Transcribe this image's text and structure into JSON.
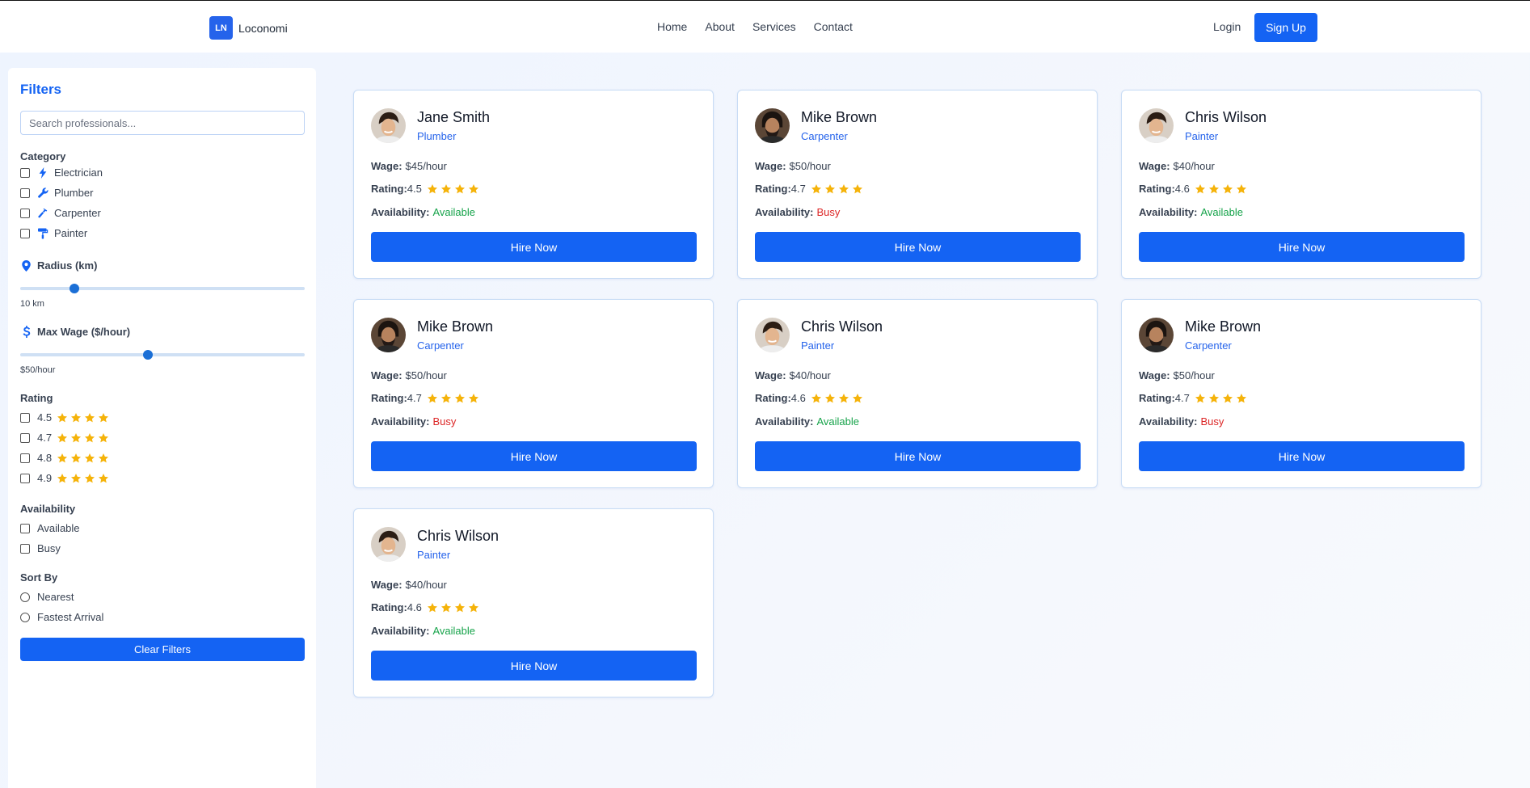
{
  "header": {
    "logo_badge": "LN",
    "app_name": "Loconomi",
    "nav": [
      "Home",
      "About",
      "Services",
      "Contact"
    ],
    "login": "Login",
    "signup": "Sign Up"
  },
  "sidebar": {
    "title": "Filters",
    "search_placeholder": "Search professionals...",
    "category_title": "Category",
    "categories": [
      {
        "label": "Electrician",
        "icon": "bolt-icon"
      },
      {
        "label": "Plumber",
        "icon": "wrench-icon"
      },
      {
        "label": "Carpenter",
        "icon": "hammer-icon"
      },
      {
        "label": "Painter",
        "icon": "paint-roller-icon"
      }
    ],
    "radius_title": "Radius (km)",
    "radius_value": "10 km",
    "radius_fraction": 0.19,
    "wage_title": "Max Wage ($/hour)",
    "wage_value": "$50/hour",
    "wage_fraction": 0.45,
    "rating_title": "Rating",
    "ratings": [
      "4.5",
      "4.7",
      "4.8",
      "4.9"
    ],
    "availability_title": "Availability",
    "availability": [
      "Available",
      "Busy"
    ],
    "sort_title": "Sort By",
    "sort": [
      "Nearest",
      "Fastest Arrival"
    ],
    "clear_label": "Clear Filters"
  },
  "labels": {
    "wage": "Wage:",
    "rating": "Rating:",
    "availability": "Availability:",
    "hire": "Hire Now"
  },
  "cards": [
    {
      "name": "Jane Smith",
      "role": "Plumber",
      "wage": "$45/hour",
      "rating": "4.5",
      "availability": "Available"
    },
    {
      "name": "Mike Brown",
      "role": "Carpenter",
      "wage": "$50/hour",
      "rating": "4.7",
      "availability": "Busy"
    },
    {
      "name": "Chris Wilson",
      "role": "Painter",
      "wage": "$40/hour",
      "rating": "4.6",
      "availability": "Available"
    },
    {
      "name": "Mike Brown",
      "role": "Carpenter",
      "wage": "$50/hour",
      "rating": "4.7",
      "availability": "Busy"
    },
    {
      "name": "Chris Wilson",
      "role": "Painter",
      "wage": "$40/hour",
      "rating": "4.6",
      "availability": "Available"
    },
    {
      "name": "Mike Brown",
      "role": "Carpenter",
      "wage": "$50/hour",
      "rating": "4.7",
      "availability": "Busy"
    },
    {
      "name": "Chris Wilson",
      "role": "Painter",
      "wage": "$40/hour",
      "rating": "4.6",
      "availability": "Available"
    }
  ],
  "colors": {
    "accent": "#1463f3",
    "available": "#16a34a",
    "busy": "#dc2626",
    "star": "#f5b30a"
  }
}
